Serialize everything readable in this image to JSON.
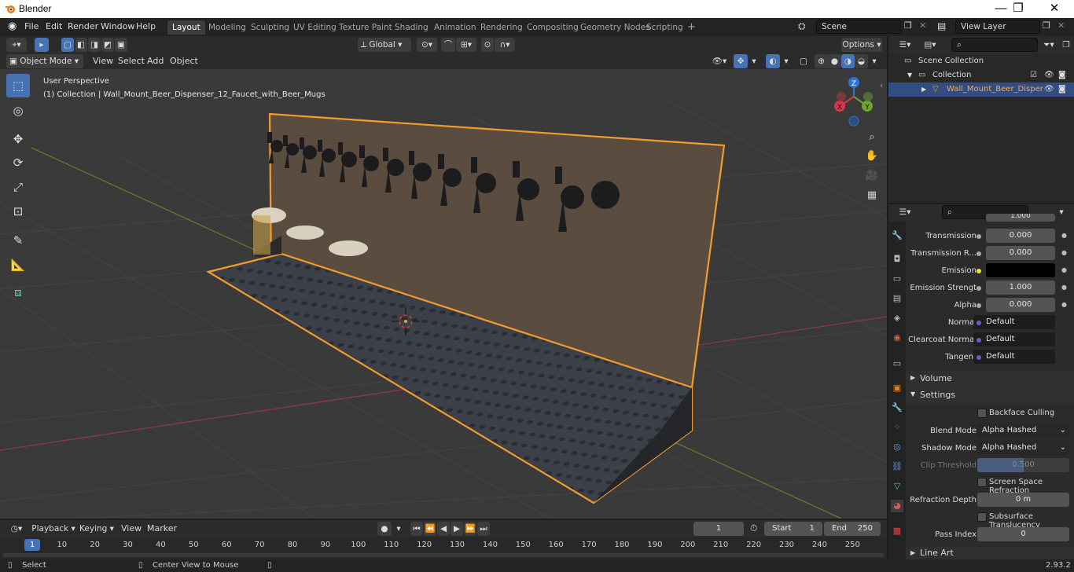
{
  "window": {
    "title": "Blender",
    "minimize": "—",
    "maximize": "❐",
    "close": "✕"
  },
  "menu": [
    "File",
    "Edit",
    "Render",
    "Window",
    "Help"
  ],
  "workspaces": [
    "Layout",
    "Modeling",
    "Sculpting",
    "UV Editing",
    "Texture Paint",
    "Shading",
    "Animation",
    "Rendering",
    "Compositing",
    "Geometry Nodes",
    "Scripting"
  ],
  "add_workspace": "+",
  "scene": {
    "name": "Scene",
    "view_layer": "View Layer"
  },
  "viewport": {
    "orientation": "Global",
    "options_label": "Options",
    "mode": "Object Mode",
    "menus": [
      "View",
      "Select",
      "Add",
      "Object"
    ],
    "perspective_label": "User Perspective",
    "collection_label": "(1) Collection | Wall_Mount_Beer_Dispenser_12_Faucet_with_Beer_Mugs",
    "gizmo": {
      "z": "Z",
      "y": "Y",
      "x": "X"
    }
  },
  "outliner": {
    "rows": [
      {
        "label": "Scene Collection"
      },
      {
        "label": "Collection"
      },
      {
        "label": "Wall_Mount_Beer_Disper"
      }
    ]
  },
  "properties": {
    "truncated_value": "1.000",
    "rows": [
      {
        "label": "Transmission",
        "value": "0.000"
      },
      {
        "label": "Transmission R...",
        "value": "0.000"
      },
      {
        "label": "Emission",
        "value": ""
      },
      {
        "label": "Emission Strengt",
        "value": "1.000"
      },
      {
        "label": "Alpha",
        "value": "0.000"
      },
      {
        "label": "Normal",
        "value": "Default"
      },
      {
        "label": "Clearcoat Normal",
        "value": "Default"
      },
      {
        "label": "Tangent",
        "value": "Default"
      }
    ],
    "volume_label": "Volume",
    "settings_label": "Settings",
    "backface_culling": "Backface Culling",
    "blend_mode": {
      "label": "Blend Mode",
      "value": "Alpha Hashed"
    },
    "shadow_mode": {
      "label": "Shadow Mode",
      "value": "Alpha Hashed"
    },
    "clip_threshold": {
      "label": "Clip Threshold",
      "value": "0.500"
    },
    "screen_space_refraction": "Screen Space Refraction",
    "refraction_depth": {
      "label": "Refraction Depth",
      "value": "0 m"
    },
    "subsurface_translucency": "Subsurface Translucency",
    "pass_index": {
      "label": "Pass Index",
      "value": "0"
    },
    "line_art": "Line Art",
    "colors": {
      "emission": "#000000",
      "accent": "#4772b3",
      "selection": "#f39b2f"
    }
  },
  "timeline": {
    "menus": [
      "Playback",
      "Keying",
      "View",
      "Marker"
    ],
    "current_frame": "1",
    "start_label": "Start",
    "start": "1",
    "end_label": "End",
    "end": "250",
    "ticks": [
      "1",
      "10",
      "20",
      "30",
      "40",
      "50",
      "60",
      "70",
      "80",
      "90",
      "100",
      "110",
      "120",
      "130",
      "140",
      "150",
      "160",
      "170",
      "180",
      "190",
      "200",
      "210",
      "220",
      "230",
      "240",
      "250"
    ]
  },
  "status": {
    "select": "Select",
    "center_view": "Center View to Mouse",
    "version": "2.93.2"
  }
}
